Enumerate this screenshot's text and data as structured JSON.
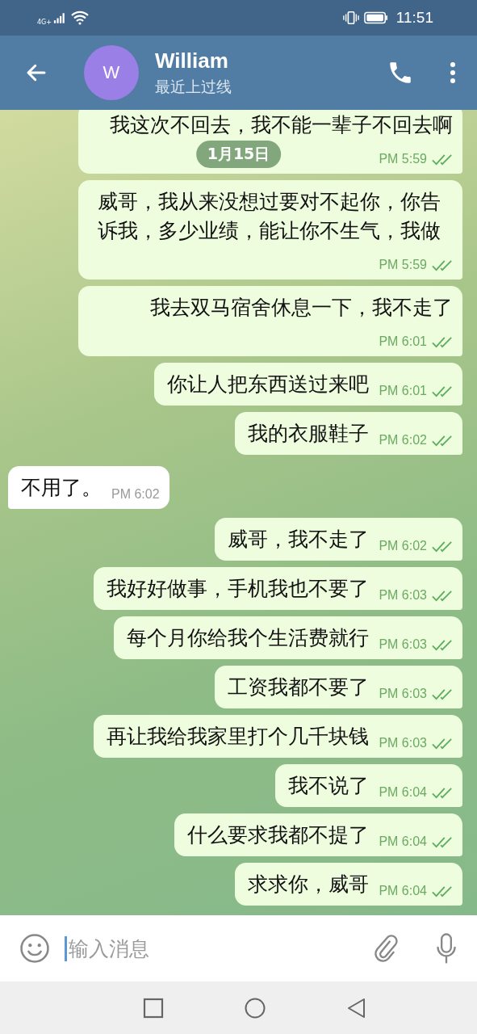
{
  "status_bar": {
    "network": "4G+",
    "time": "11:51"
  },
  "header": {
    "avatar_letter": "W",
    "title": "William",
    "subtitle": "最近上过线"
  },
  "date_pill": "1月15日",
  "messages": [
    {
      "kind": "outgoing",
      "text": "我这次不回去，我不能一辈子不回去啊",
      "time": "PM 5:59",
      "read": true
    },
    {
      "kind": "outgoing",
      "text": "威哥，我从来没想过要对不起你，你告诉我，多少业绩，能让你不生气，我做",
      "time": "PM 5:59",
      "read": true
    },
    {
      "kind": "outgoing",
      "text": "我去双马宿舍休息一下，我不走了",
      "time": "PM 6:01",
      "read": true
    },
    {
      "kind": "outgoing",
      "text": "你让人把东西送过来吧",
      "time": "PM 6:01",
      "read": true
    },
    {
      "kind": "outgoing",
      "text": "我的衣服鞋子",
      "time": "PM 6:02",
      "read": true
    },
    {
      "kind": "incoming",
      "text": "不用了。",
      "time": "PM 6:02"
    },
    {
      "kind": "outgoing",
      "text": "威哥，我不走了",
      "time": "PM 6:02",
      "read": true
    },
    {
      "kind": "outgoing",
      "text": "我好好做事，手机我也不要了",
      "time": "PM 6:03",
      "read": true
    },
    {
      "kind": "outgoing",
      "text": "每个月你给我个生活费就行",
      "time": "PM 6:03",
      "read": true
    },
    {
      "kind": "outgoing",
      "text": "工资我都不要了",
      "time": "PM 6:03",
      "read": true
    },
    {
      "kind": "outgoing",
      "text": "再让我给我家里打个几千块钱",
      "time": "PM 6:03",
      "read": true
    },
    {
      "kind": "outgoing",
      "text": "我不说了",
      "time": "PM 6:04",
      "read": true
    },
    {
      "kind": "outgoing",
      "text": "什么要求我都不提了",
      "time": "PM 6:04",
      "read": true
    },
    {
      "kind": "outgoing",
      "text": "求求你，威哥",
      "time": "PM 6:04",
      "read": true
    }
  ],
  "input": {
    "placeholder": "输入消息"
  }
}
